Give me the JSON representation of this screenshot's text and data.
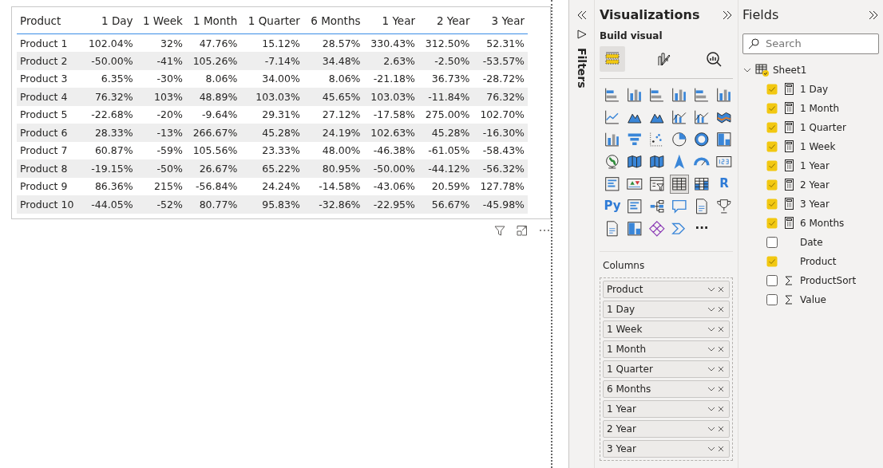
{
  "table": {
    "columns": [
      "Product",
      "1 Day",
      "1 Week",
      "1 Month",
      "1 Quarter",
      "6 Months",
      "1 Year",
      "2 Year",
      "3 Year"
    ],
    "rows": [
      [
        "Product 1",
        "102.04%",
        "32%",
        "47.76%",
        "15.12%",
        "28.57%",
        "330.43%",
        "312.50%",
        "52.31%"
      ],
      [
        "Product 2",
        "-50.00%",
        "-41%",
        "105.26%",
        "-7.14%",
        "34.48%",
        "2.63%",
        "-2.50%",
        "-53.57%"
      ],
      [
        "Product 3",
        "6.35%",
        "-30%",
        "8.06%",
        "34.00%",
        "8.06%",
        "-21.18%",
        "36.73%",
        "-28.72%"
      ],
      [
        "Product 4",
        "76.32%",
        "103%",
        "48.89%",
        "103.03%",
        "45.65%",
        "103.03%",
        "-11.84%",
        "76.32%"
      ],
      [
        "Product 5",
        "-22.68%",
        "-20%",
        "-9.64%",
        "29.31%",
        "27.12%",
        "-17.58%",
        "275.00%",
        "102.70%"
      ],
      [
        "Product 6",
        "28.33%",
        "-13%",
        "266.67%",
        "45.28%",
        "24.19%",
        "102.63%",
        "45.28%",
        "-16.30%"
      ],
      [
        "Product 7",
        "60.87%",
        "-59%",
        "105.56%",
        "23.33%",
        "48.00%",
        "-46.38%",
        "-61.05%",
        "-58.43%"
      ],
      [
        "Product 8",
        "-19.15%",
        "-50%",
        "26.67%",
        "65.22%",
        "80.95%",
        "-50.00%",
        "-44.12%",
        "-56.32%"
      ],
      [
        "Product 9",
        "86.36%",
        "215%",
        "-56.84%",
        "24.24%",
        "-14.58%",
        "-43.06%",
        "20.59%",
        "127.78%"
      ],
      [
        "Product 10",
        "-44.05%",
        "-52%",
        "80.77%",
        "95.83%",
        "-32.86%",
        "-22.95%",
        "56.67%",
        "-45.98%"
      ]
    ]
  },
  "filters": {
    "title": "Filters"
  },
  "visualizations": {
    "title": "Visualizations",
    "subtitle": "Build visual",
    "modes": [
      {
        "kind": "fields",
        "selected": true
      },
      {
        "kind": "format",
        "selected": false
      },
      {
        "kind": "analytics",
        "selected": false
      }
    ],
    "visuals": [
      {
        "kind": "hbar",
        "selected": false
      },
      {
        "kind": "vbar",
        "selected": false
      },
      {
        "kind": "hbar",
        "selected": false
      },
      {
        "kind": "vbar",
        "selected": false
      },
      {
        "kind": "hbar",
        "selected": false
      },
      {
        "kind": "vbar",
        "selected": false
      },
      {
        "kind": "line",
        "selected": false
      },
      {
        "kind": "area",
        "selected": false
      },
      {
        "kind": "area",
        "selected": false
      },
      {
        "kind": "combo",
        "selected": false
      },
      {
        "kind": "combo",
        "selected": false
      },
      {
        "kind": "ribbon",
        "selected": false
      },
      {
        "kind": "vbar",
        "selected": false
      },
      {
        "kind": "funnel",
        "selected": false
      },
      {
        "kind": "scatter",
        "selected": false
      },
      {
        "kind": "pie",
        "selected": false
      },
      {
        "kind": "donut",
        "selected": false
      },
      {
        "kind": "treemap",
        "selected": false
      },
      {
        "kind": "globe",
        "selected": false
      },
      {
        "kind": "map",
        "selected": false
      },
      {
        "kind": "map",
        "selected": false
      },
      {
        "kind": "arrow",
        "selected": false
      },
      {
        "kind": "gauge",
        "selected": false
      },
      {
        "kind": "card",
        "selected": false
      },
      {
        "kind": "list",
        "selected": false
      },
      {
        "kind": "kpi",
        "selected": false
      },
      {
        "kind": "slicer",
        "selected": false
      },
      {
        "kind": "table",
        "selected": true
      },
      {
        "kind": "matrix",
        "selected": false
      },
      {
        "kind": "text",
        "label": "R",
        "selected": false
      },
      {
        "kind": "text",
        "label": "Py",
        "selected": false
      },
      {
        "kind": "list",
        "selected": false
      },
      {
        "kind": "tree",
        "selected": false
      },
      {
        "kind": "chat",
        "selected": false
      },
      {
        "kind": "doc",
        "selected": false
      },
      {
        "kind": "trophy",
        "selected": false
      },
      {
        "kind": "doc",
        "selected": false
      },
      {
        "kind": "treemap",
        "selected": false
      },
      {
        "kind": "diamond",
        "selected": false
      },
      {
        "kind": "chevron",
        "selected": false
      },
      {
        "kind": "text",
        "label": "···",
        "selected": false
      }
    ],
    "wells_title": "Columns",
    "wells": [
      "Product",
      "1 Day",
      "1 Week",
      "1 Month",
      "1 Quarter",
      "6 Months",
      "1 Year",
      "2 Year",
      "3 Year"
    ]
  },
  "fields": {
    "title": "Fields",
    "search": {
      "placeholder": "Search"
    },
    "table": {
      "name": "Sheet1",
      "expanded": true,
      "children": [
        {
          "name": "1 Day",
          "kind": "measure",
          "checked": true
        },
        {
          "name": "1 Month",
          "kind": "measure",
          "checked": true
        },
        {
          "name": "1 Quarter",
          "kind": "measure",
          "checked": true
        },
        {
          "name": "1 Week",
          "kind": "measure",
          "checked": true
        },
        {
          "name": "1 Year",
          "kind": "measure",
          "checked": true
        },
        {
          "name": "2 Year",
          "kind": "measure",
          "checked": true
        },
        {
          "name": "3 Year",
          "kind": "measure",
          "checked": true
        },
        {
          "name": "6 Months",
          "kind": "measure",
          "checked": true
        },
        {
          "name": "Date",
          "kind": "plain",
          "checked": false
        },
        {
          "name": "Product",
          "kind": "plain",
          "checked": true
        },
        {
          "name": "ProductSort",
          "kind": "sum",
          "checked": false
        },
        {
          "name": "Value",
          "kind": "sum",
          "checked": false
        }
      ]
    }
  }
}
